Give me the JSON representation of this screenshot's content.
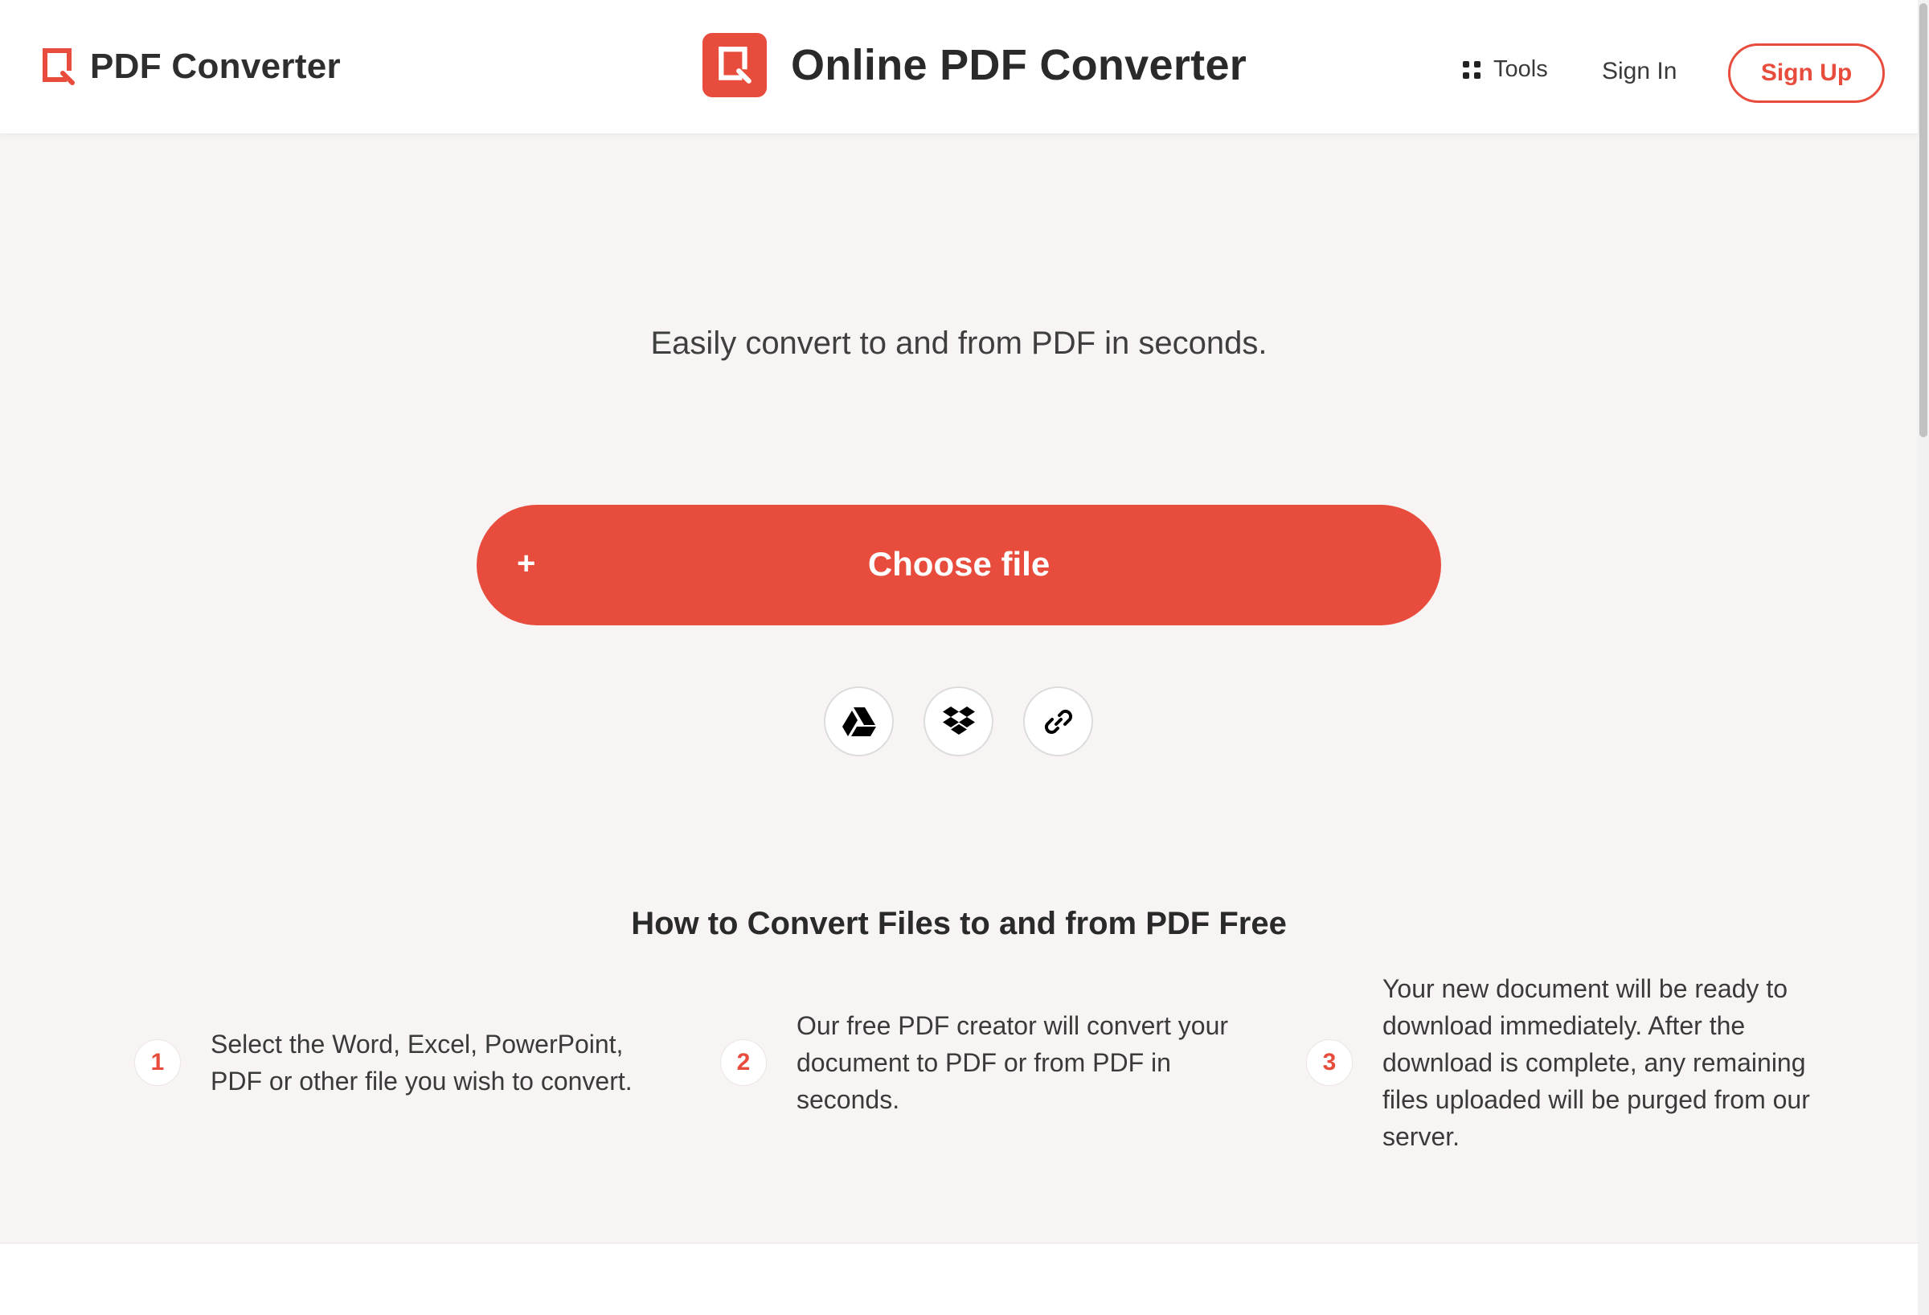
{
  "header": {
    "brand_name": "PDF Converter",
    "center_title": "Online PDF Converter",
    "nav": {
      "tools_label": "Tools",
      "sign_in_label": "Sign In",
      "sign_up_label": "Sign Up"
    }
  },
  "hero": {
    "tagline": "Easily convert to and from PDF in seconds.",
    "choose_file_icon": "+",
    "choose_file_label": "Choose file",
    "upload_sources": [
      "google-drive-icon",
      "dropbox-icon",
      "link-icon"
    ]
  },
  "howto": {
    "heading": "How to Convert Files to and from PDF Free",
    "steps": [
      {
        "number": "1",
        "text": "Select the Word, Excel, PowerPoint, PDF or other file you wish to convert."
      },
      {
        "number": "2",
        "text": "Our free PDF creator will convert your document to PDF or from PDF in seconds."
      },
      {
        "number": "3",
        "text": "Your new document will be ready to download immediately. After the download is complete, any remaining files uploaded will be purged from our server."
      }
    ]
  },
  "colors": {
    "accent": "#e84c3d",
    "background": "#f7f4f3",
    "text": "#333333"
  }
}
